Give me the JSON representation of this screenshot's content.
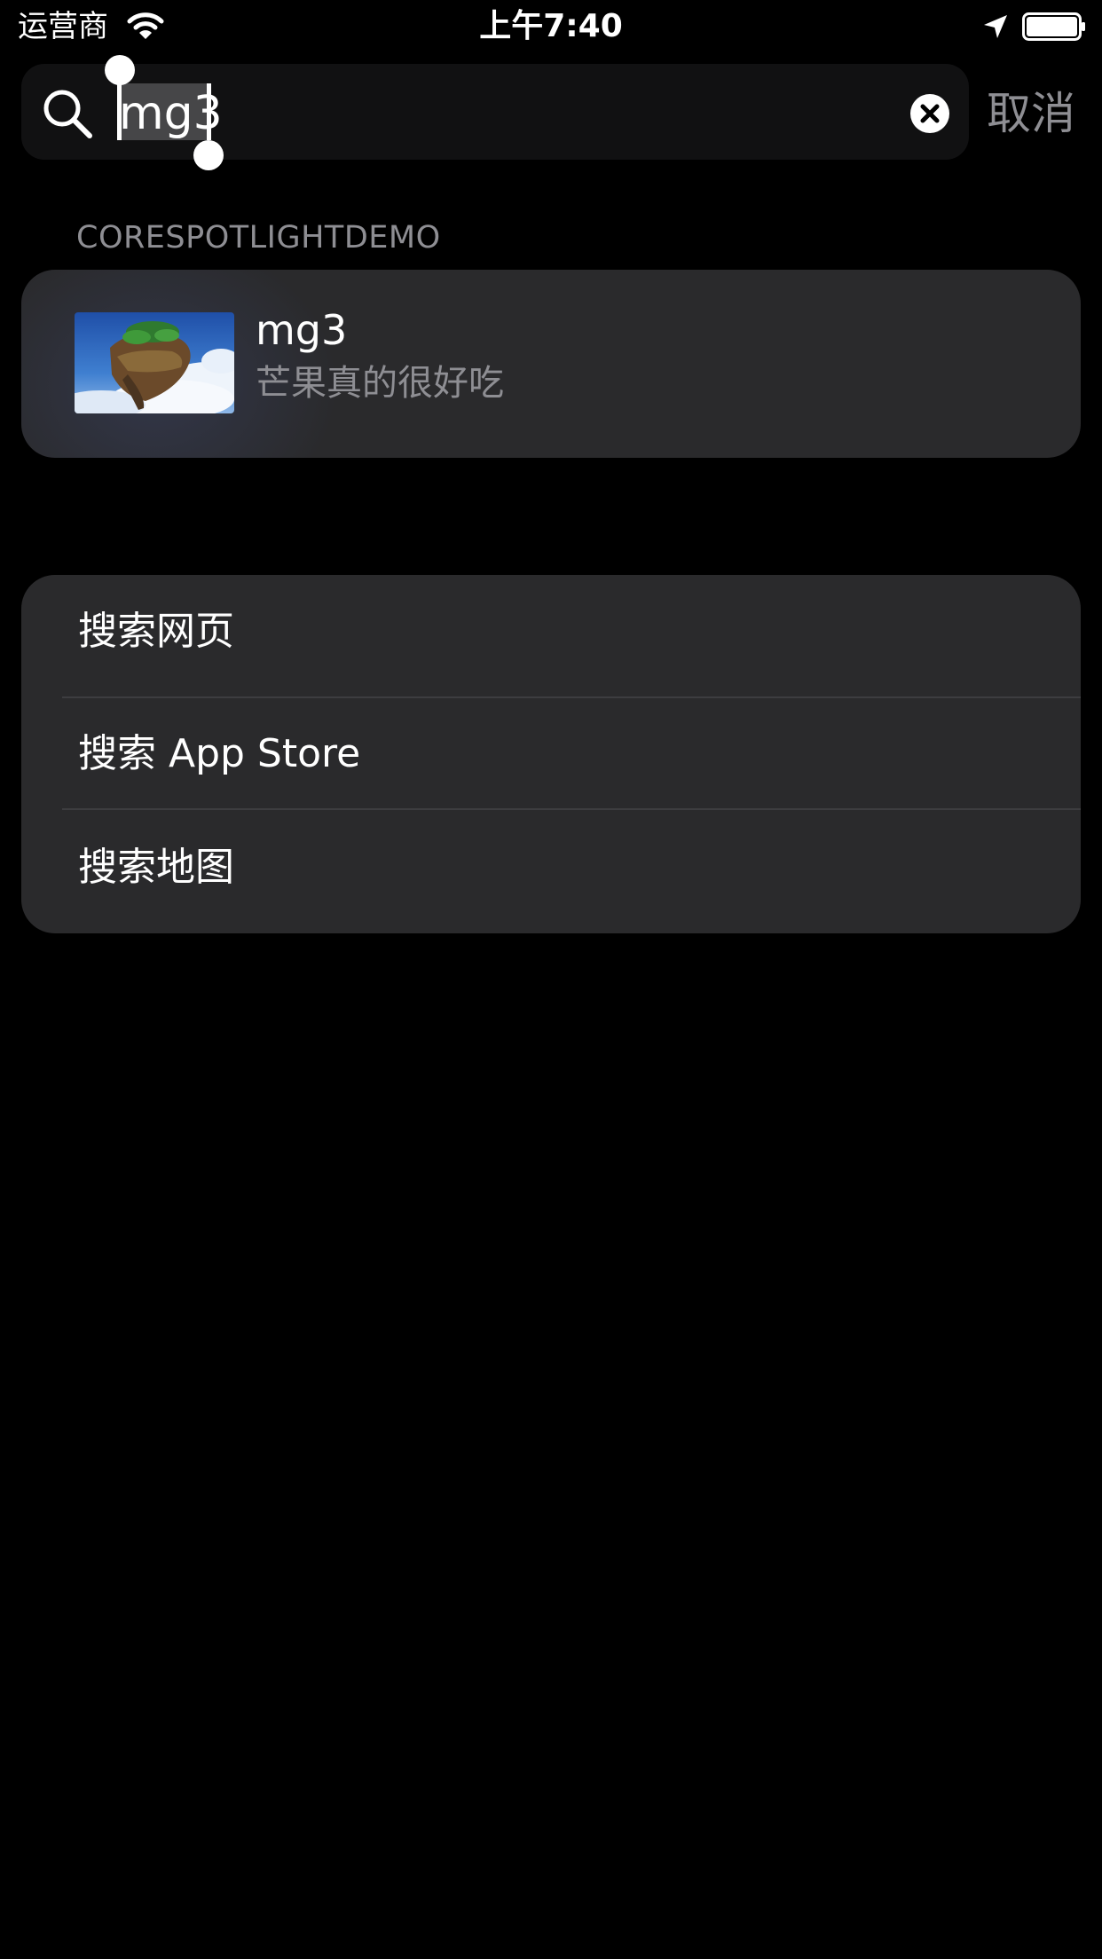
{
  "status_bar": {
    "carrier": "运营商",
    "time": "上午7:40",
    "icons": [
      "wifi-icon",
      "location-arrow-icon",
      "battery-icon"
    ]
  },
  "search": {
    "query": "mg3",
    "cancel_label": "取消",
    "icons": [
      "search-icon",
      "clear-icon"
    ]
  },
  "results": {
    "section_title": "CORESPOTLIGHTDEMO",
    "items": [
      {
        "title": "mg3",
        "subtitle": "芒果真的很好吃",
        "thumbnail_icon": "floating-island-thumbnail"
      }
    ]
  },
  "search_options": [
    {
      "label": "搜索网页"
    },
    {
      "label": "搜索 App Store"
    },
    {
      "label": "搜索地图"
    }
  ],
  "colors": {
    "background": "#000000",
    "card": "#2a2a2c",
    "field": "#111112",
    "secondary_text": "#8e8e93",
    "divider": "#3d3d40"
  }
}
